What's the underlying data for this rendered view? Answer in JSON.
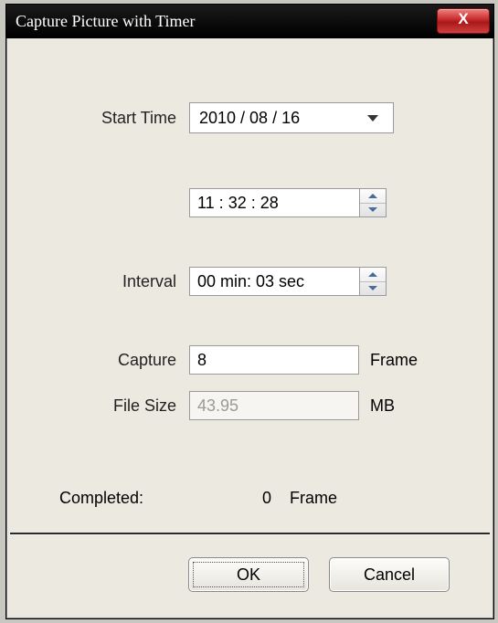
{
  "window": {
    "title": "Capture Picture with Timer",
    "close_glyph": "X"
  },
  "labels": {
    "start_time": "Start Time",
    "interval": "Interval",
    "capture": "Capture",
    "file_size": "File Size",
    "completed": "Completed:",
    "frame_unit": "Frame",
    "mb_unit": "MB"
  },
  "values": {
    "date": "2010 / 08 / 16",
    "time": "11 : 32 : 28",
    "interval": "00 min: 03 sec",
    "capture": "8",
    "file_size": "43.95",
    "completed_count": "0"
  },
  "buttons": {
    "ok": "OK",
    "cancel": "Cancel"
  }
}
